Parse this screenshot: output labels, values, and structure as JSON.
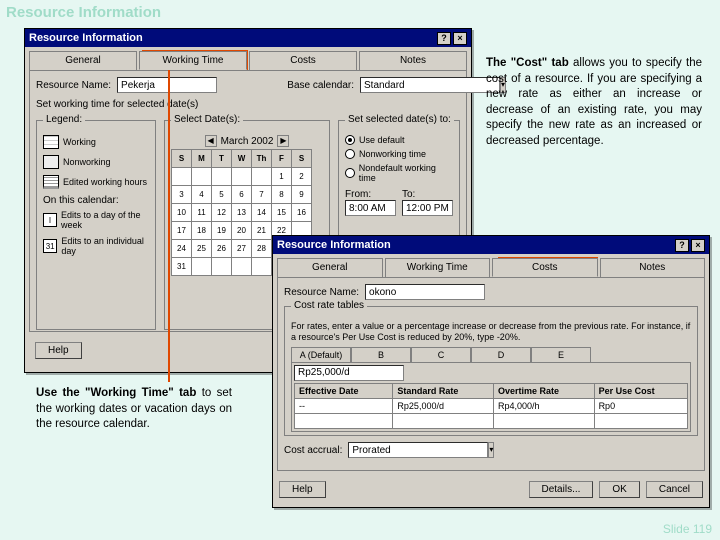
{
  "page_title": "Resource Information",
  "slide_num": "Slide 119",
  "win1": {
    "title": "Resource Information",
    "tabs": [
      "General",
      "Working Time",
      "Costs",
      "Notes"
    ],
    "resource_name_label": "Resource Name:",
    "resource_name": "Pekerja",
    "base_cal_label": "Base calendar:",
    "base_cal": "Standard",
    "set_working_label": "Set working time for selected date(s)",
    "legend_title": "Legend:",
    "legend": {
      "working": "Working",
      "nonworking": "Nonworking",
      "edited": "Edited working hours"
    },
    "on_calendar": "On this calendar:",
    "edits_week": "Edits to a day of the week",
    "edits_day": "Edits to an individual day",
    "day_i": "I",
    "day_31": "31",
    "select_dates": "Select Date(s):",
    "month": "March 2002",
    "dow": [
      "S",
      "M",
      "T",
      "W",
      "Th",
      "F",
      "S"
    ],
    "weeks": [
      [
        "",
        "",
        "",
        "",
        "",
        "1",
        "2"
      ],
      [
        "3",
        "4",
        "5",
        "6",
        "7",
        "8",
        "9"
      ],
      [
        "10",
        "11",
        "12",
        "13",
        "14",
        "15",
        "16"
      ],
      [
        "17",
        "18",
        "19",
        "20",
        "21",
        "22",
        ""
      ],
      [
        "24",
        "25",
        "26",
        "27",
        "28",
        "",
        ""
      ],
      [
        "31",
        "",
        "",
        "",
        "",
        "",
        ""
      ]
    ],
    "set_selected": "Set selected date(s) to:",
    "r_default": "Use default",
    "r_nonwork": "Nonworking time",
    "r_nondef": "Nondefault working time",
    "from": "From:",
    "to": "To:",
    "from_val": "8:00 AM",
    "to_val": "12:00 PM",
    "help": "Help"
  },
  "win2": {
    "title": "Resource Information",
    "tabs": [
      "General",
      "Working Time",
      "Costs",
      "Notes"
    ],
    "resource_name_label": "Resource Name:",
    "resource_name": "okono",
    "cost_tables": "Cost rate tables",
    "instruction": "For rates, enter a value or a percentage increase or decrease from the previous rate. For instance, if a resource's Per Use Cost is reduced by 20%, type -20%.",
    "stabs": [
      "A (Default)",
      "B",
      "C",
      "D",
      "E"
    ],
    "rate_value": "Rp25,000/d",
    "headers": [
      "Effective Date",
      "Standard Rate",
      "Overtime Rate",
      "Per Use Cost"
    ],
    "data_row": [
      "--",
      "Rp25,000/d",
      "Rp4,000/h",
      "Rp0"
    ],
    "cost_accrual_label": "Cost accrual:",
    "cost_accrual": "Prorated",
    "help": "Help",
    "details": "Details...",
    "ok": "OK",
    "cancel": "Cancel"
  },
  "callout_cost": "The \"Cost\" tab allows you to specify the cost of a resource. If you are specifying a new rate as either an increase or decrease of an existing rate, you may specify the new rate as an increased or decreased percentage.",
  "callout_wt_bold": "Use the \"Working Time\" tab",
  "callout_wt": " to set the working dates or vacation days on the resource calendar."
}
